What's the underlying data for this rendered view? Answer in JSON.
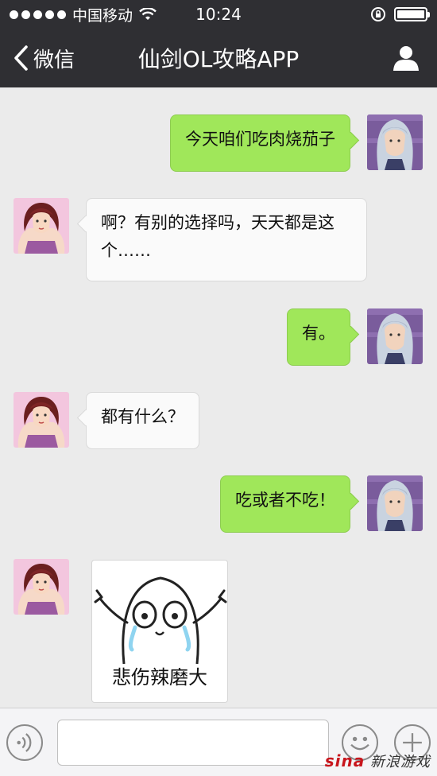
{
  "status_bar": {
    "carrier": "中国移动",
    "time": "10:24"
  },
  "nav": {
    "back_label": "微信",
    "title": "仙剑OL攻略APP"
  },
  "messages": [
    {
      "side": "right",
      "text": "今天咱们吃肉烧茄子"
    },
    {
      "side": "left",
      "text": "啊？有别的选择吗，天天都是这个……"
    },
    {
      "side": "right",
      "text": "有。"
    },
    {
      "side": "left",
      "text": "都有什么？"
    },
    {
      "side": "right",
      "text": "吃或者不吃！"
    },
    {
      "side": "left",
      "sticker_caption": "悲伤辣磨大"
    }
  ],
  "watermark": {
    "brand": "sina",
    "text": "新浪游戏"
  },
  "colors": {
    "header_bg": "#2f2f33",
    "chat_bg": "#ebebeb",
    "bubble_right": "#a0e75a",
    "bubble_left": "#fafafa"
  },
  "icons": {
    "back": "chevron-left-icon",
    "profile": "person-icon",
    "voice": "voice-icon",
    "emoji": "smiley-icon",
    "more": "plus-icon"
  }
}
